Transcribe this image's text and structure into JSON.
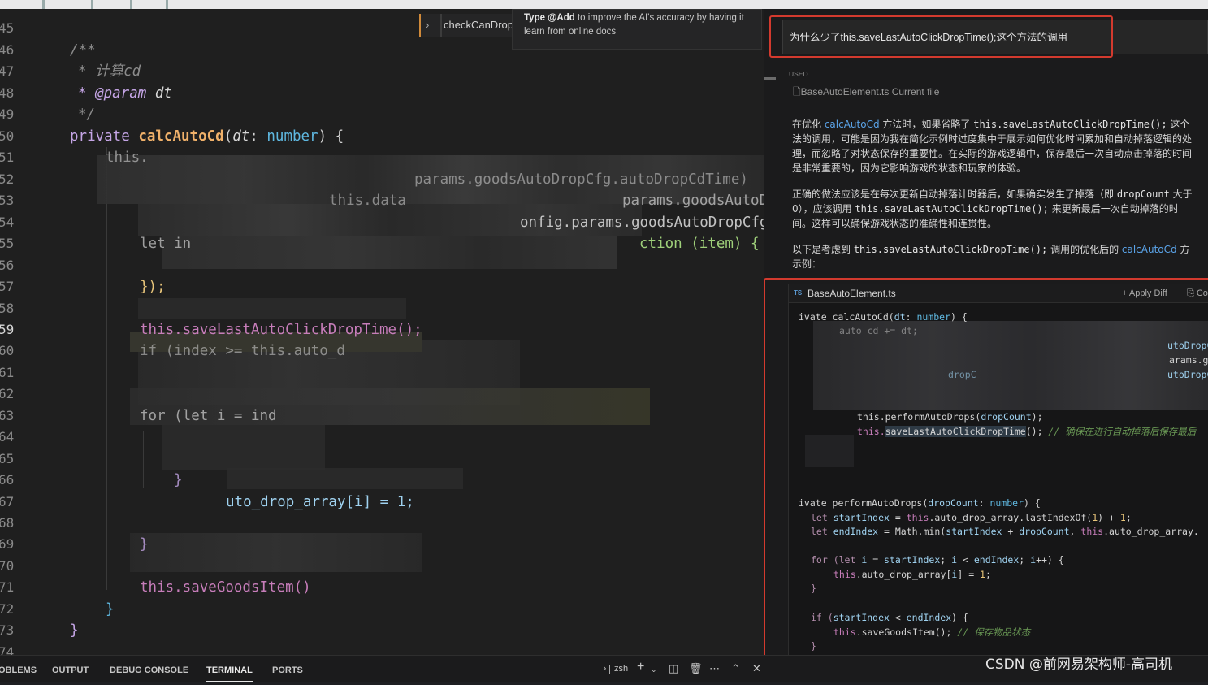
{
  "editor": {
    "line_numbers": [
      "45",
      "46",
      "47",
      "48",
      "49",
      "50",
      "51",
      "52",
      "53",
      "54",
      "55",
      "56",
      "57",
      "58",
      "59",
      "60",
      "61",
      "62",
      "63",
      "64",
      "65",
      "66",
      "67",
      "68",
      "69",
      "70",
      "71",
      "72",
      "73",
      "74"
    ],
    "current_line": "59",
    "comment_open": "/**",
    "comment_calc": "* 计算cd",
    "comment_param_tag": "* @param",
    "comment_param_name": "dt",
    "comment_close": "*/",
    "decl_private": "private",
    "decl_fn": "calcAutoCd",
    "decl_open": "(",
    "decl_param": "dt",
    "decl_colon": ": ",
    "decl_type": "number",
    "decl_close": ") {",
    "frag_this": "this.",
    "frag_params": "params.goodsAutoDropCfg.autoDropCdTime)",
    "frag_data": "this.data",
    "frag_params2": "params.goodsAutoDropCf",
    "frag_config": "onfig.params.goodsAutoDropCfg.",
    "frag_let": "let in",
    "frag_action": "ction (item) {",
    "close_paren": "});",
    "save_call": "this.saveLastAutoClickDropTime();",
    "frag_if": "if (index >= this.auto_d",
    "frag_for": "for (let i = ind",
    "close_brace_inner": "}",
    "frag_drop_array": "uto_drop_array[i] = 1;",
    "close_brace_mid": "}",
    "save_goods": "this.saveGoodsItem()",
    "close_brace_a": "}",
    "close_brace_b": "}"
  },
  "sticky_scroll": {
    "label": "checkCanDrop"
  },
  "tooltip": {
    "bold": "Type @Add",
    "rest": " to improve the AI's accuracy by having it learn from online docs"
  },
  "chat": {
    "query": "为什么少了this.saveLastAutoClickDropTime();这个方法的调用",
    "used_label": "USED",
    "used_file": "BaseAutoElement.ts Current file",
    "p1_lines": [
      [
        "在优化 ",
        "calcAutoCd",
        " 方法时，如果省略了 ",
        "this.saveLastAutoClickDropTime();",
        " 这个"
      ],
      [
        "法的调用，可能是因为我在简化示例时过度集中于展示如何优化时间累加和自动掉落逻辑的处"
      ],
      [
        "理，而忽略了对状态保存的重要性。在实际的游戏逻辑中，保存最后一次自动点击掉落的时间"
      ],
      [
        "是非常重要的，因为它影响游戏的状态和玩家的体验。"
      ]
    ],
    "p2_lines": [
      [
        "正确的做法应该是在每次更新自动掉落计时器后，如果确实发生了掉落（即 ",
        "dropCount",
        " 大于"
      ],
      [
        "0），应该调用 ",
        "this.saveLastAutoClickDropTime();",
        " 来更新最后一次自动掉落的时"
      ],
      [
        "间。这样可以确保游戏状态的准确性和连贯性。"
      ]
    ],
    "p3_lines": [
      [
        "以下是考虑到 ",
        "this.saveLastAutoClickDropTime();",
        " 调用的优化后的 ",
        "calcAutoCd",
        " 方"
      ],
      [
        "示例："
      ]
    ],
    "codeblock": {
      "lang_badge": "TS",
      "filename": "BaseAutoElement.ts",
      "apply_label": "+ Apply Diff",
      "copy_label": "⎘ Co",
      "l1": [
        "ivate ",
        "calcAutoCd",
        "(",
        "dt",
        ": ",
        "number",
        ") {"
      ],
      "l2": "auto_cd += dt;",
      "l3r": "utoDropC",
      "l4r": "arams.g",
      "l5": "dropC",
      "l5r": "utoDropC",
      "l6": [
        "this.performAutoDrops(",
        "dropCount",
        ");"
      ],
      "l7": [
        "this.",
        "saveLastAutoClickDropTime",
        "(); ",
        "// 确保在进行自动掉落后保存最后"
      ],
      "l8": [
        "ivate ",
        "performAutoDrops",
        "(",
        "dropCount",
        ": ",
        "number",
        ") {"
      ],
      "l9": [
        "let ",
        "startIndex",
        " = ",
        "this",
        ".auto_drop_array.lastIndexOf(",
        "1",
        ") + ",
        "1",
        ";"
      ],
      "l10": [
        "let ",
        "endIndex",
        " = Math.min(",
        "startIndex",
        " + ",
        "dropCount",
        ", ",
        "this",
        ".auto_drop_array."
      ],
      "l11": [
        "for (",
        "let ",
        "i",
        " = ",
        "startIndex",
        "; ",
        "i",
        " < ",
        "endIndex",
        "; ",
        "i",
        "++) {"
      ],
      "l12": [
        "this",
        ".auto_drop_array[",
        "i",
        "] = ",
        "1",
        ";"
      ],
      "l13": "}",
      "l14": [
        "if (",
        "startIndex",
        " < ",
        "endIndex",
        ") {"
      ],
      "l15": [
        "this",
        ".saveGoodsItem(); ",
        "// 保存物品状态"
      ],
      "l16": "}"
    }
  },
  "bottom_panel": {
    "tabs": [
      "OBLEMS",
      "OUTPUT",
      "DEBUG CONSOLE",
      "TERMINAL",
      "PORTS"
    ],
    "active_tab": "TERMINAL",
    "terminal_name": "zsh"
  },
  "watermark": "CSDN @前网易架构师-高司机",
  "colors": {
    "annotation_red": "#d33a2e",
    "link_blue": "#5aa3e8"
  }
}
